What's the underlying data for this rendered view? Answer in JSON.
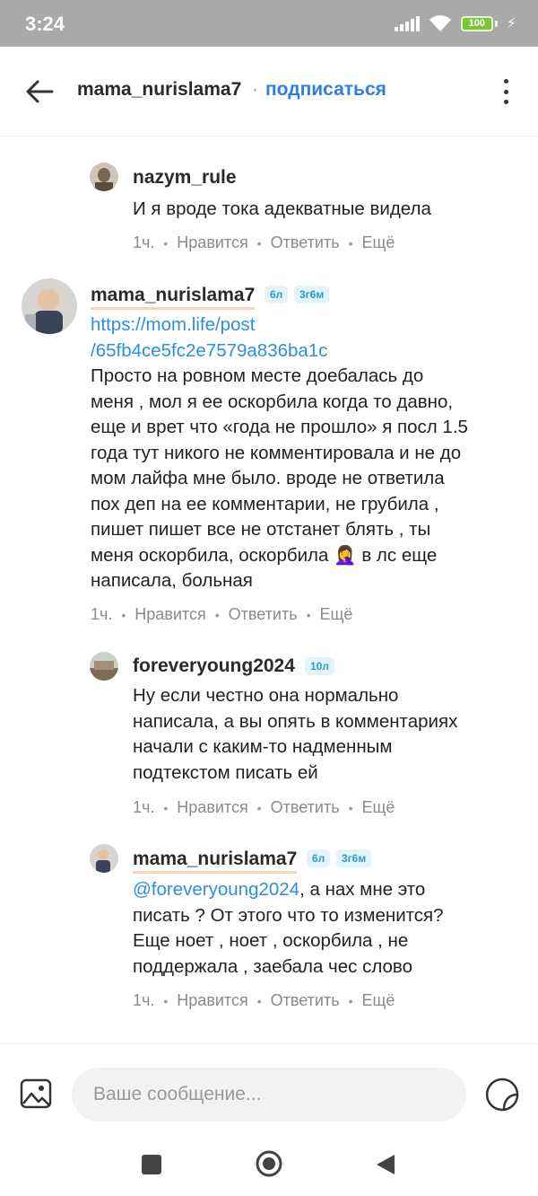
{
  "status": {
    "time": "3:24",
    "battery": "100"
  },
  "header": {
    "title": "mama_nurislama7",
    "dot": "·",
    "subscribe": "подписаться"
  },
  "comments": [
    {
      "user": "nazym_rule",
      "text": "И я вроде тока адекватные видела",
      "time": "1ч.",
      "like": "Нравится",
      "reply": "Ответить",
      "more": "Ещё"
    },
    {
      "user": "mama_nurislama7",
      "badges": [
        "6л",
        "3г6м"
      ],
      "link1": "https://mom.life/post",
      "link2": "/65fb4ce5fc2e7579a836ba1c",
      "lines": [
        "Просто на ровном месте доебалась до",
        "меня , мол я ее оскорбила когда то давно,",
        "еще и врет что «года не прошло» я посл 1.5",
        "года тут никого не комментировала и не до",
        "мом лайфа мне было. вроде не ответила",
        "пох деп на ее комментарии, не грубила ,",
        "пишет пишет все не отстанет блять , ты",
        "меня оскорбила, оскорбила 🤦‍♀️ в лс еще",
        "написала, больная"
      ],
      "time": "1ч.",
      "like": "Нравится",
      "reply": "Ответить",
      "more": "Ещё"
    },
    {
      "user": "foreveryoung2024",
      "badges": [
        "10л"
      ],
      "lines": [
        "Ну если честно она нормально",
        "написала, а вы опять в комментариях",
        "начали с каким-то надменным",
        "подтекстом писать ей"
      ],
      "time": "1ч.",
      "like": "Нравится",
      "reply": "Ответить",
      "more": "Ещё"
    },
    {
      "user": "mama_nurislama7",
      "badges": [
        "6л",
        "3г6м"
      ],
      "mention": "@foreveryoung2024",
      "first_rest": ", а нах мне это",
      "lines": [
        "писать ? От этого что то изменится?",
        "Еще ноет , ноет , оскорбила , не",
        "поддержала , заебала чес слово"
      ],
      "time": "1ч.",
      "like": "Нравится",
      "reply": "Ответить",
      "more": "Ещё"
    }
  ],
  "composer": {
    "placeholder": "Ваше сообщение..."
  },
  "icons": {
    "back": "arrow-left-icon",
    "menu": "kebab-menu-icon",
    "gallery": "image-icon",
    "sticker": "sticker-icon",
    "wifi": "wifi-icon",
    "signal": "signal-icon"
  },
  "colors": {
    "accent": "#2d7fe0",
    "badge_bg": "#e3f3fa",
    "badge_text": "#2c9ccc",
    "underline": "#fbd3bd"
  }
}
